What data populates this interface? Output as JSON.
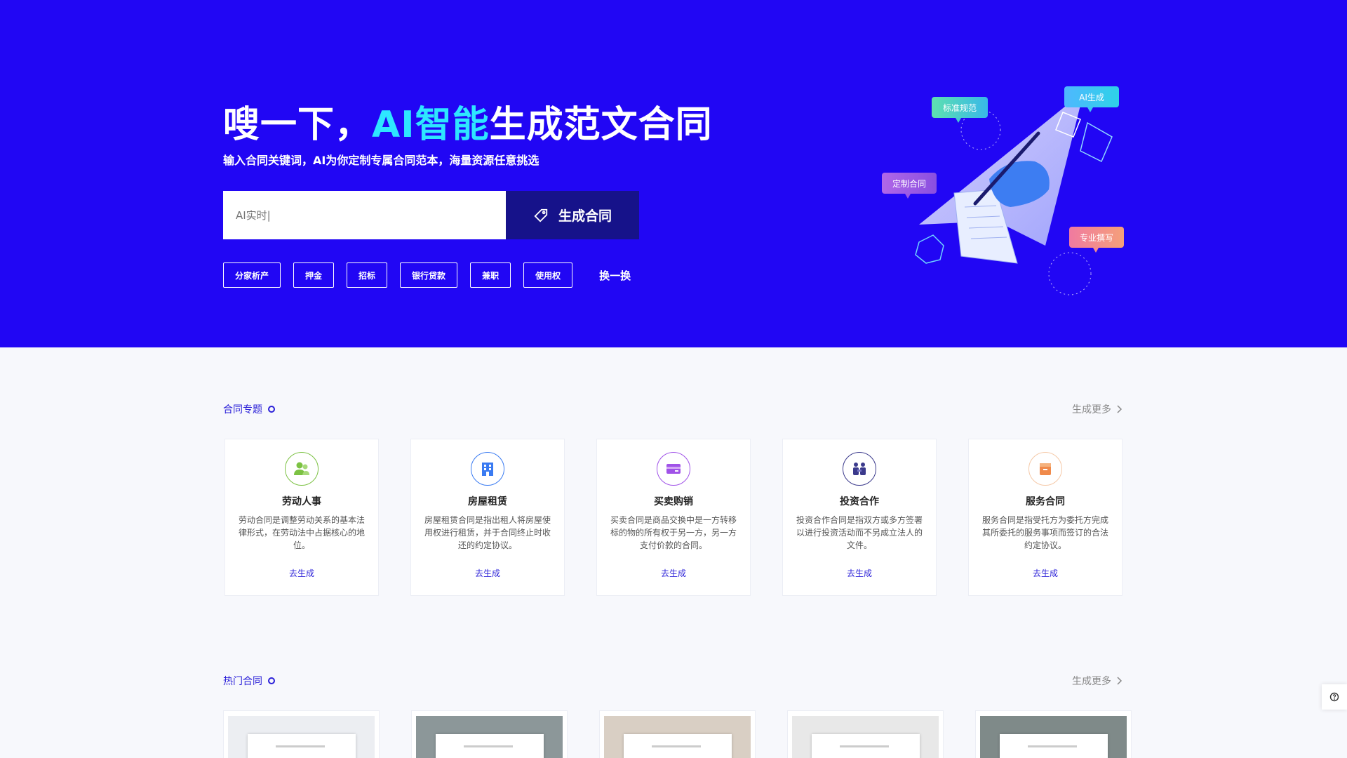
{
  "hero": {
    "title_pre": "嗖一下，",
    "title_ai": "AI智能",
    "title_post": "生成范文合同",
    "subtitle": "输入合同关键词，AI为你定制专属合同范本，海量资源任意挑选",
    "search_placeholder": "AI实时|",
    "generate_label": "生成合同",
    "tags": [
      "分家析产",
      "押金",
      "招标",
      "银行贷款",
      "兼职",
      "使用权"
    ],
    "swap_label": "换一换",
    "illustration_labels": {
      "standard": "标准规范",
      "ai": "AI生成",
      "custom": "定制合同",
      "pro": "专业撰写"
    }
  },
  "topics": {
    "title": "合同专题",
    "more_label": "生成更多",
    "cards": [
      {
        "title": "劳动人事",
        "desc": "劳动合同是调整劳动关系的基本法律形式，在劳动法中占据核心的地位。",
        "link": "去生成",
        "icon": "people-icon",
        "color": "#7cc243"
      },
      {
        "title": "房屋租赁",
        "desc": "房屋租赁合同是指出租人将房屋使用权进行租赁，并于合同终止时收还的约定协议。",
        "link": "去生成",
        "icon": "building-icon",
        "color": "#3a7bf2"
      },
      {
        "title": "买卖购销",
        "desc": "买卖合同是商品交换中是一方转移标的物的所有权于另一方，另一方支付价款的合同。",
        "link": "去生成",
        "icon": "card-icon",
        "color": "#a052e8"
      },
      {
        "title": "投资合作",
        "desc": "投资合作合同是指双方或多方签署以进行投资活动而不另成立法人的文件。",
        "link": "去生成",
        "icon": "handshake-icon",
        "color": "#3b3a8c"
      },
      {
        "title": "服务合同",
        "desc": "服务合同是指受托方为委托方完成其所委托的服务事项而签订的合法约定协议。",
        "link": "去生成",
        "icon": "box-icon",
        "color": "#f08a4b"
      }
    ]
  },
  "hot": {
    "title": "热门合同",
    "more_label": "生成更多"
  },
  "colors": {
    "hero_bg": "#2106f4",
    "accent": "#2a1fd8",
    "ai_highlight": "#2ee6ff"
  }
}
